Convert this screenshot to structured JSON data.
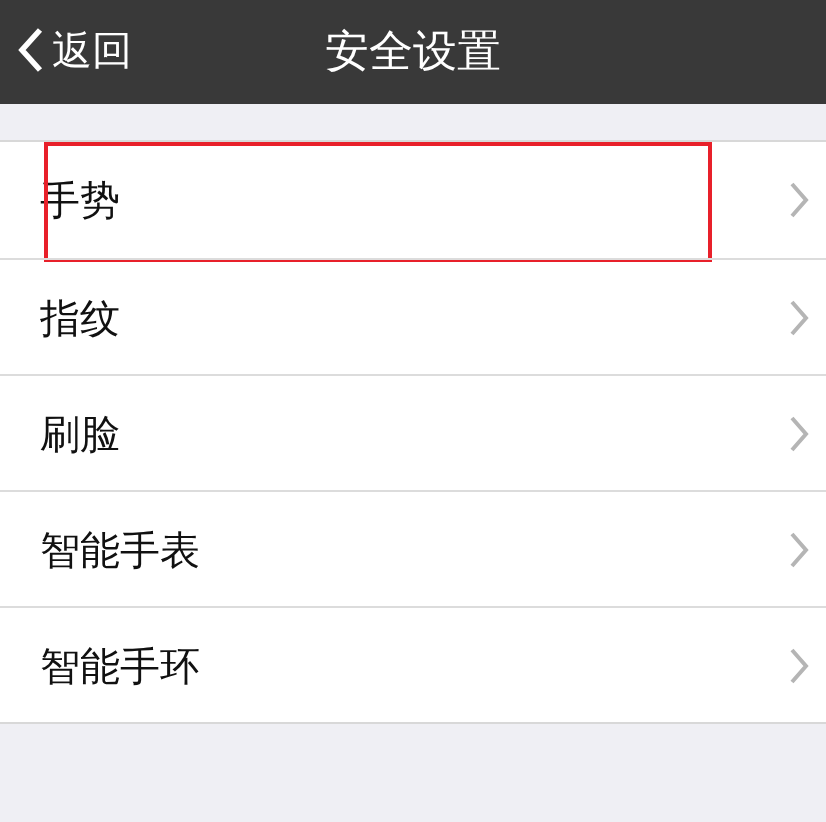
{
  "nav_bar": {
    "back": "返回",
    "title": "安全设置"
  },
  "items": [
    {
      "label": "手势",
      "highlighted": true
    },
    {
      "label": "指纹",
      "highlighted": false
    },
    {
      "label": "刷脸",
      "highlighted": false
    },
    {
      "label": "智能手表",
      "highlighted": false
    },
    {
      "label": "智能手环",
      "highlighted": false
    }
  ]
}
